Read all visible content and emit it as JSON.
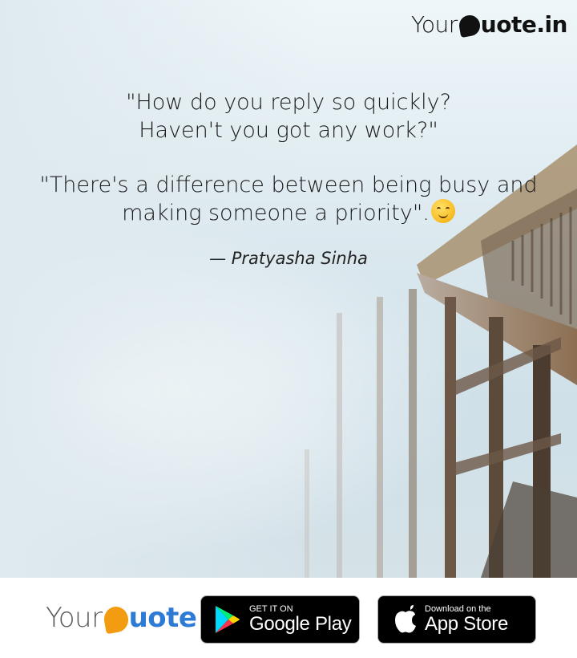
{
  "brand": {
    "your": "Your",
    "uote_top": "uote.in",
    "uote_bottom": "uote"
  },
  "quote": {
    "line1": "\"How do you reply so quickly?",
    "line2": "Haven't you got any work?\"",
    "line3": "\"There's a difference between being busy and",
    "line4": "making someone a priority\"."
  },
  "author": "— Pratyasha Sinha",
  "badges": {
    "google_play": {
      "small": "GET IT ON",
      "large": "Google Play"
    },
    "app_store": {
      "small": "Download on the",
      "large": "App Store"
    }
  },
  "colors": {
    "brand_blue": "#2e7bd6",
    "brand_orange": "#f39c12",
    "badge_bg": "#000000"
  },
  "icons": [
    "quote-bubble-icon",
    "smiling-emoji-icon",
    "google-play-icon",
    "apple-icon"
  ]
}
